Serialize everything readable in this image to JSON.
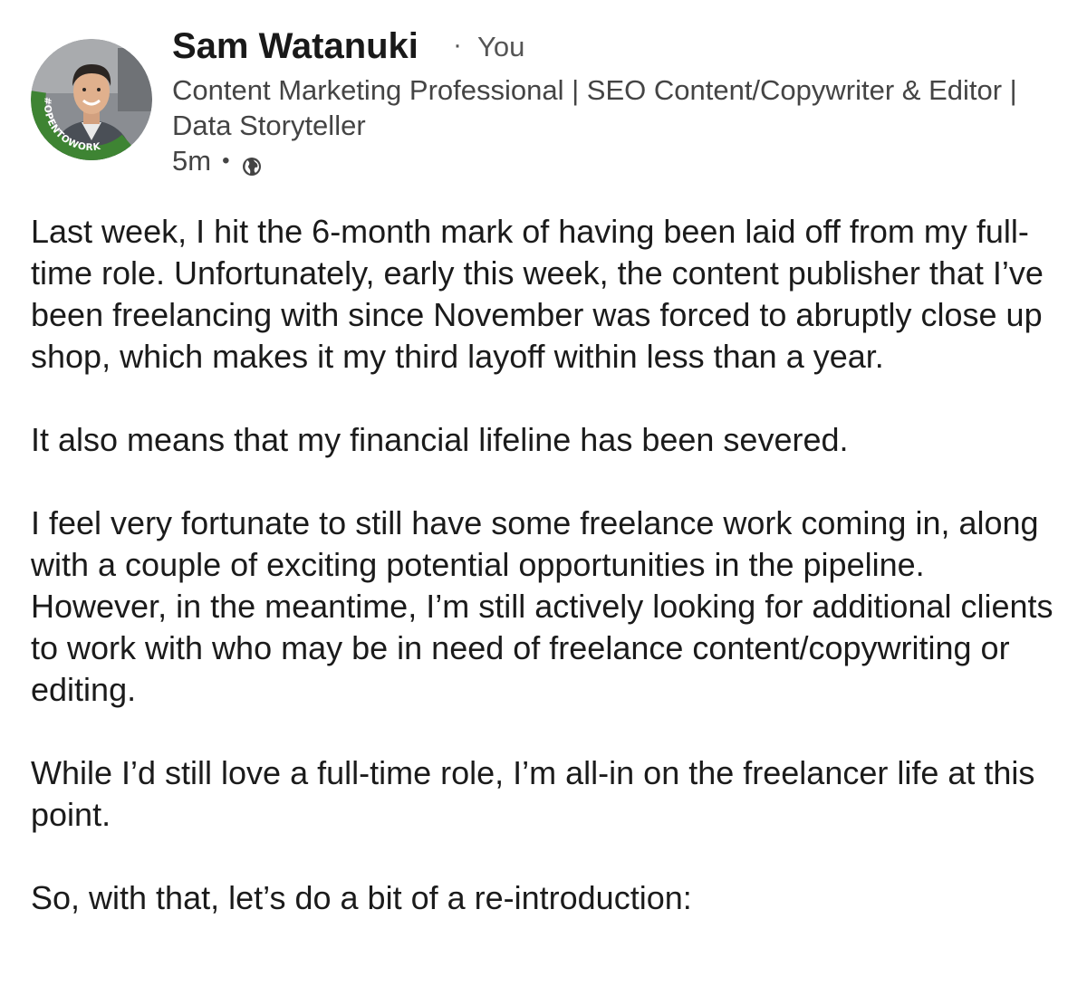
{
  "post": {
    "author": {
      "name": "Sam Watanuki",
      "relation": "You",
      "separator": "·",
      "badge_text": "#OPENTOWORK",
      "headline": "Content Marketing Professional | SEO Content/Copywriter & Editor | Data Storyteller"
    },
    "meta": {
      "time": "5m",
      "separator": "•",
      "visibility_icon": "globe-icon"
    },
    "colors": {
      "badge_green": "#3e8433",
      "text": "#1b1b1b",
      "secondary_text": "#444444"
    },
    "paragraphs": [
      "Last week, I hit the 6-month mark of having been laid off from my full-time role. Unfortunately, early this week, the content publisher that I’ve been freelancing with since November was forced to abruptly close up shop, which makes it my third layoff within less than a year.",
      "It also means that my financial lifeline has been severed.",
      "I feel very fortunate to still have some freelance work coming in, along with a couple of exciting potential opportunities in the pipeline. However, in the meantime, I’m still actively looking for additional clients to work with who may be in need of freelance content/copywriting or editing.",
      "While I’d still love a full-time role, I’m all-in on the freelancer life at this point.",
      "So, with that, let’s do a bit of a re-introduction:"
    ]
  }
}
